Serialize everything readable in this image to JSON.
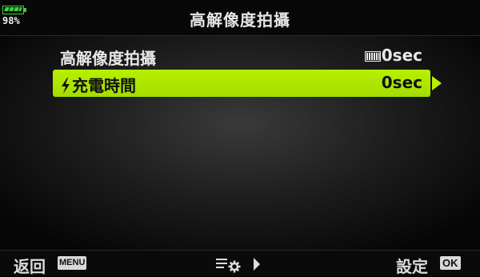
{
  "status": {
    "battery_percent": "98%",
    "battery_level": 0.98
  },
  "header": {
    "title": "高解像度拍攝"
  },
  "menu": {
    "items": [
      {
        "label": "高解像度拍攝",
        "value": "0sec",
        "icon": "sequential-shot-icon",
        "selected": false
      },
      {
        "label": "充電時間",
        "value": "0sec",
        "icon": "flash-icon",
        "selected": true
      }
    ]
  },
  "footer": {
    "back_label": "返回",
    "back_key": "MENU",
    "mid_icon": "menu-settings-icon",
    "set_label": "設定",
    "set_key": "OK"
  },
  "colors": {
    "highlight": "#b0e800",
    "battery": "#3bd13b",
    "background": "#000000"
  }
}
